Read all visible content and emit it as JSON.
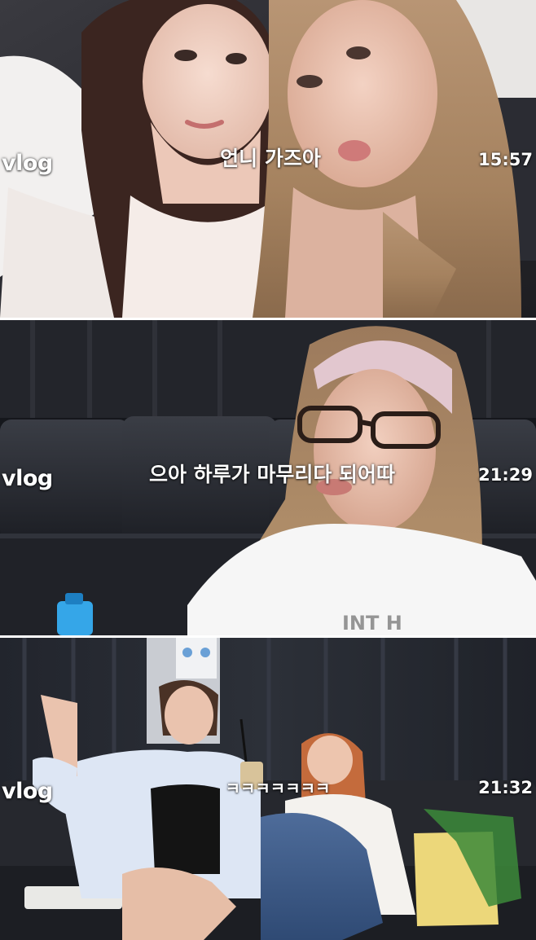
{
  "frames": [
    {
      "tag": "vlog",
      "caption": "언니 가즈아",
      "time": "15:57"
    },
    {
      "tag": "vlog",
      "caption": "으아 하루가 마무리다 되어따",
      "time": "21:29"
    },
    {
      "tag": "vlog",
      "caption": "ㅋㅋㅋㅋㅋㅋㅋ",
      "time": "21:32"
    }
  ],
  "colors": {
    "overlay_text": "#ffffff",
    "frame_divider": "#ffffff"
  }
}
